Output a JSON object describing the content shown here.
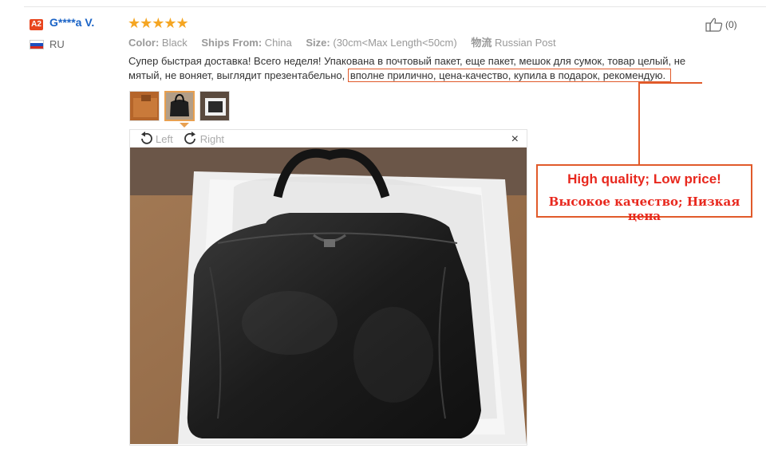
{
  "reviewer": {
    "badge": "A2",
    "name": "G****a V.",
    "country": "RU",
    "flag_colors": [
      "#ffffff",
      "#1c4fbf",
      "#d52b1e"
    ]
  },
  "review": {
    "stars": "★★★★★",
    "attributes": [
      {
        "label": "Color:",
        "value": "Black"
      },
      {
        "label": "Ships From:",
        "value": "China"
      },
      {
        "label": "Size:",
        "value": "(30cm<Max Length<50cm)"
      },
      {
        "label": "物流",
        "value": "Russian Post"
      }
    ],
    "helpful_count": "(0)",
    "text_plain": "Супер быстрая доставка! Всего неделя! Упакована в почтовый пакет, еще пакет, мешок для сумок, товар целый, не мятый, не воняет, выглядит презентабельно,",
    "text_highlight": "вполне прилично, цена-качество, купила в подарок, рекомендую."
  },
  "viewer": {
    "rotate_left": "Left",
    "rotate_right": "Right",
    "close": "×"
  },
  "callout": {
    "english": "High quality; Low price!",
    "russian": "Высокое качество; Низкая цена"
  },
  "colors": {
    "accent": "#e15a2a",
    "link": "#1a63c6",
    "star": "#f5a623"
  }
}
